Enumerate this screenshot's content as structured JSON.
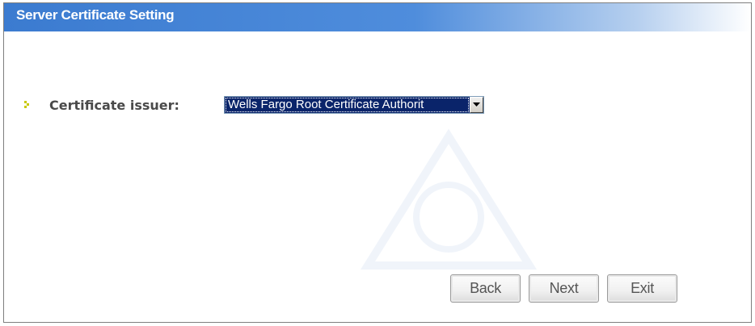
{
  "window": {
    "title": "Server Certificate Setting"
  },
  "form": {
    "issuer_label": "Certificate issuer:",
    "issuer_value": "Wells Fargo Root Certificate Authorit",
    "bullet_icon": "chevron-right-icon",
    "dropdown_icon": "chevron-down-icon"
  },
  "buttons": {
    "back": "Back",
    "next": "Next",
    "exit": "Exit"
  },
  "colors": {
    "title_bar": "#3b7bd0",
    "bullet": "#c8c800",
    "selection": "#0a246a"
  }
}
